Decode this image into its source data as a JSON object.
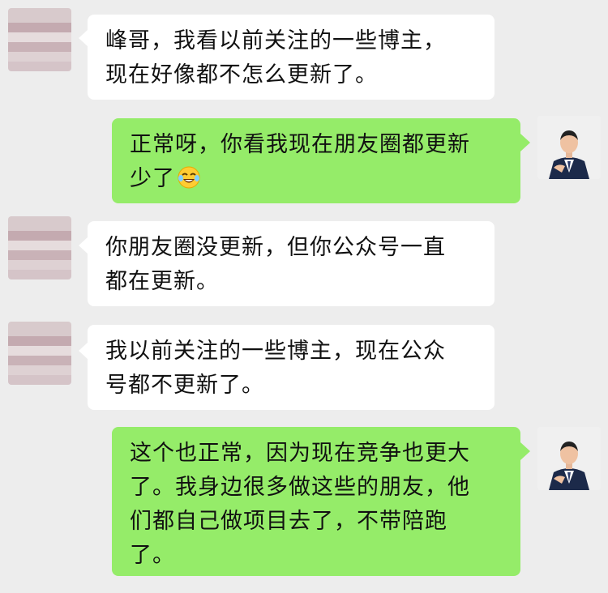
{
  "messages": [
    {
      "side": "left",
      "lines": [
        "峰哥，我看以前关注的一些博主，",
        "现在好像都不怎么更新了。"
      ]
    },
    {
      "side": "right",
      "lines": [
        "正常呀，你看我现在朋友圈都更新",
        "少了"
      ],
      "emoji": "laughing-crying-emoji"
    },
    {
      "side": "left",
      "lines": [
        "你朋友圈没更新，但你公众号一直",
        "都在更新。"
      ]
    },
    {
      "side": "left",
      "lines": [
        "我以前关注的一些博主，现在公众",
        "号都不更新了。"
      ]
    },
    {
      "side": "right",
      "lines": [
        "这个也正常，因为现在竞争也更大",
        "了。我身边很多做这些的朋友，他",
        "们都自己做项目去了，不带陪跑",
        "了。"
      ]
    }
  ],
  "colors": {
    "background": "#ededed",
    "left_bubble": "#ffffff",
    "right_bubble": "#95ec69",
    "text": "#111111"
  }
}
